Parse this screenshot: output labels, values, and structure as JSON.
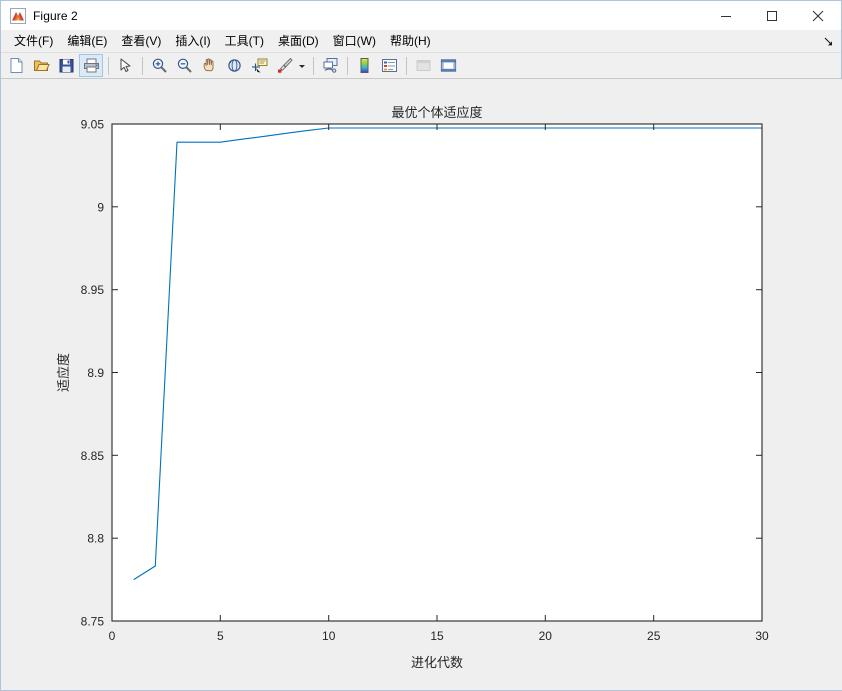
{
  "window": {
    "title": "Figure 2",
    "app_icon": "matlab-membrane-icon",
    "controls": {
      "minimize": "minimize-icon",
      "maximize": "maximize-icon",
      "close": "close-icon"
    }
  },
  "menubar": {
    "items": [
      {
        "label": "文件(F)",
        "name": "menu-file"
      },
      {
        "label": "编辑(E)",
        "name": "menu-edit"
      },
      {
        "label": "查看(V)",
        "name": "menu-view"
      },
      {
        "label": "插入(I)",
        "name": "menu-insert"
      },
      {
        "label": "工具(T)",
        "name": "menu-tools"
      },
      {
        "label": "桌面(D)",
        "name": "menu-desktop"
      },
      {
        "label": "窗口(W)",
        "name": "menu-window"
      },
      {
        "label": "帮助(H)",
        "name": "menu-help"
      }
    ],
    "overflow_icon": "menu-overflow-arrow-icon"
  },
  "toolbar": {
    "buttons": [
      {
        "name": "new-figure-icon",
        "tooltip": "新建图窗"
      },
      {
        "name": "open-file-icon",
        "tooltip": "打开文件"
      },
      {
        "name": "save-figure-icon",
        "tooltip": "保存图窗"
      },
      {
        "name": "print-figure-icon",
        "tooltip": "打印图窗",
        "state": "pressed"
      },
      {
        "name": "edit-plot-pointer-icon",
        "tooltip": "编辑绘图"
      },
      {
        "name": "zoom-in-icon",
        "tooltip": "放大"
      },
      {
        "name": "zoom-out-icon",
        "tooltip": "缩小"
      },
      {
        "name": "pan-hand-icon",
        "tooltip": "平移"
      },
      {
        "name": "rotate-3d-icon",
        "tooltip": "旋转三维"
      },
      {
        "name": "data-cursor-icon",
        "tooltip": "数据游标"
      },
      {
        "name": "brush-data-icon",
        "tooltip": "刷亮/选择数据"
      },
      {
        "name": "brush-dropdown-caret-icon",
        "tooltip": "刷亮选项"
      },
      {
        "name": "link-plot-icon",
        "tooltip": "链接绘图"
      },
      {
        "name": "insert-colorbar-icon",
        "tooltip": "插入颜色栏"
      },
      {
        "name": "insert-legend-icon",
        "tooltip": "插入图例"
      },
      {
        "name": "hide-plot-tools-icon",
        "tooltip": "隐藏绘图工具",
        "state": "disabled"
      },
      {
        "name": "show-plot-tools-icon",
        "tooltip": "显示绘图工具"
      }
    ]
  },
  "chart_data": {
    "type": "line",
    "title": "最优个体适应度",
    "xlabel": "进化代数",
    "ylabel": "适应度",
    "xlim": [
      0,
      30
    ],
    "ylim": [
      8.75,
      9.05
    ],
    "xticks": [
      "0",
      "5",
      "10",
      "15",
      "20",
      "25",
      "30"
    ],
    "yticks": [
      "8.75",
      "8.8",
      "8.85",
      "8.9",
      "8.95",
      "9",
      "9.05"
    ],
    "grid": false,
    "legend": null,
    "series": [
      {
        "name": "最优个体适应度",
        "color": "#0072BD",
        "linewidth": 1,
        "x": [
          1,
          2,
          3,
          4,
          5,
          6,
          7,
          8,
          9,
          10,
          11,
          12,
          13,
          14,
          15,
          16,
          17,
          18,
          19,
          20,
          21,
          22,
          23,
          24,
          25,
          26,
          27,
          28,
          29,
          30
        ],
        "y": [
          8.775,
          8.7832,
          9.039,
          9.039,
          9.039,
          9.0408,
          9.0425,
          9.0443,
          9.046,
          9.0476,
          9.0476,
          9.0476,
          9.0476,
          9.0476,
          9.0476,
          9.0476,
          9.0476,
          9.0476,
          9.0476,
          9.0476,
          9.0476,
          9.0476,
          9.0476,
          9.0476,
          9.0476,
          9.0476,
          9.0476,
          9.0476,
          9.0476,
          9.0476
        ]
      }
    ]
  },
  "colors": {
    "figure_background": "#efefef",
    "axes_background": "#ffffff",
    "axes_line": "#262626",
    "line_color": "#0072BD",
    "titlebar_background": "#ffffff",
    "toolbar_background": "#f0f0f0"
  }
}
